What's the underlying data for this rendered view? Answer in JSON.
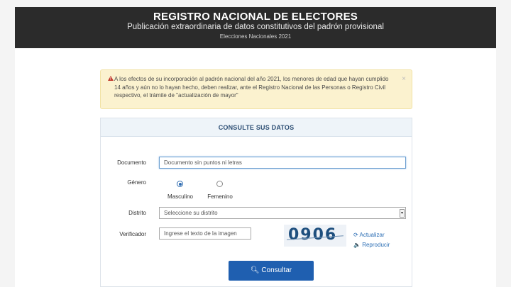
{
  "header": {
    "title": "REGISTRO NACIONAL DE ELECTORES",
    "subtitle": "Publicación extraordinaria de datos constitutivos del padrón provisional",
    "caption": "Elecciones Nacionales 2021"
  },
  "alert": {
    "text": "A los efectos de su incorporación al padrón nacional del año 2021, los menores de edad que hayan cumplido 14 años y aún no lo hayan hecho, deben realizar, ante el Registro Nacional de las Personas o Registro Civil respectivo, el trámite de \"actualización de mayor\"",
    "close": "×"
  },
  "form": {
    "heading": "CONSULTE SUS DATOS",
    "documento_label": "Documento",
    "documento_placeholder": "Documento sin puntos ni letras",
    "genero_label": "Género",
    "genero_options": [
      "Masculino",
      "Femenino"
    ],
    "genero_selected": "Masculino",
    "distrito_label": "Distrito",
    "distrito_value": "Seleccione su distrito",
    "verificador_label": "Verificador",
    "verificador_placeholder": "Ingrese el texto de la imagen",
    "captcha_text": "0906",
    "actualizar": "Actualizar",
    "reproducir": "Reproducir",
    "submit": "Consultar"
  },
  "colors": {
    "header_bg": "#2b2b2b",
    "alert_bg": "#fbf2cf",
    "button_bg": "#1f5fb0",
    "link": "#2a6db4"
  }
}
